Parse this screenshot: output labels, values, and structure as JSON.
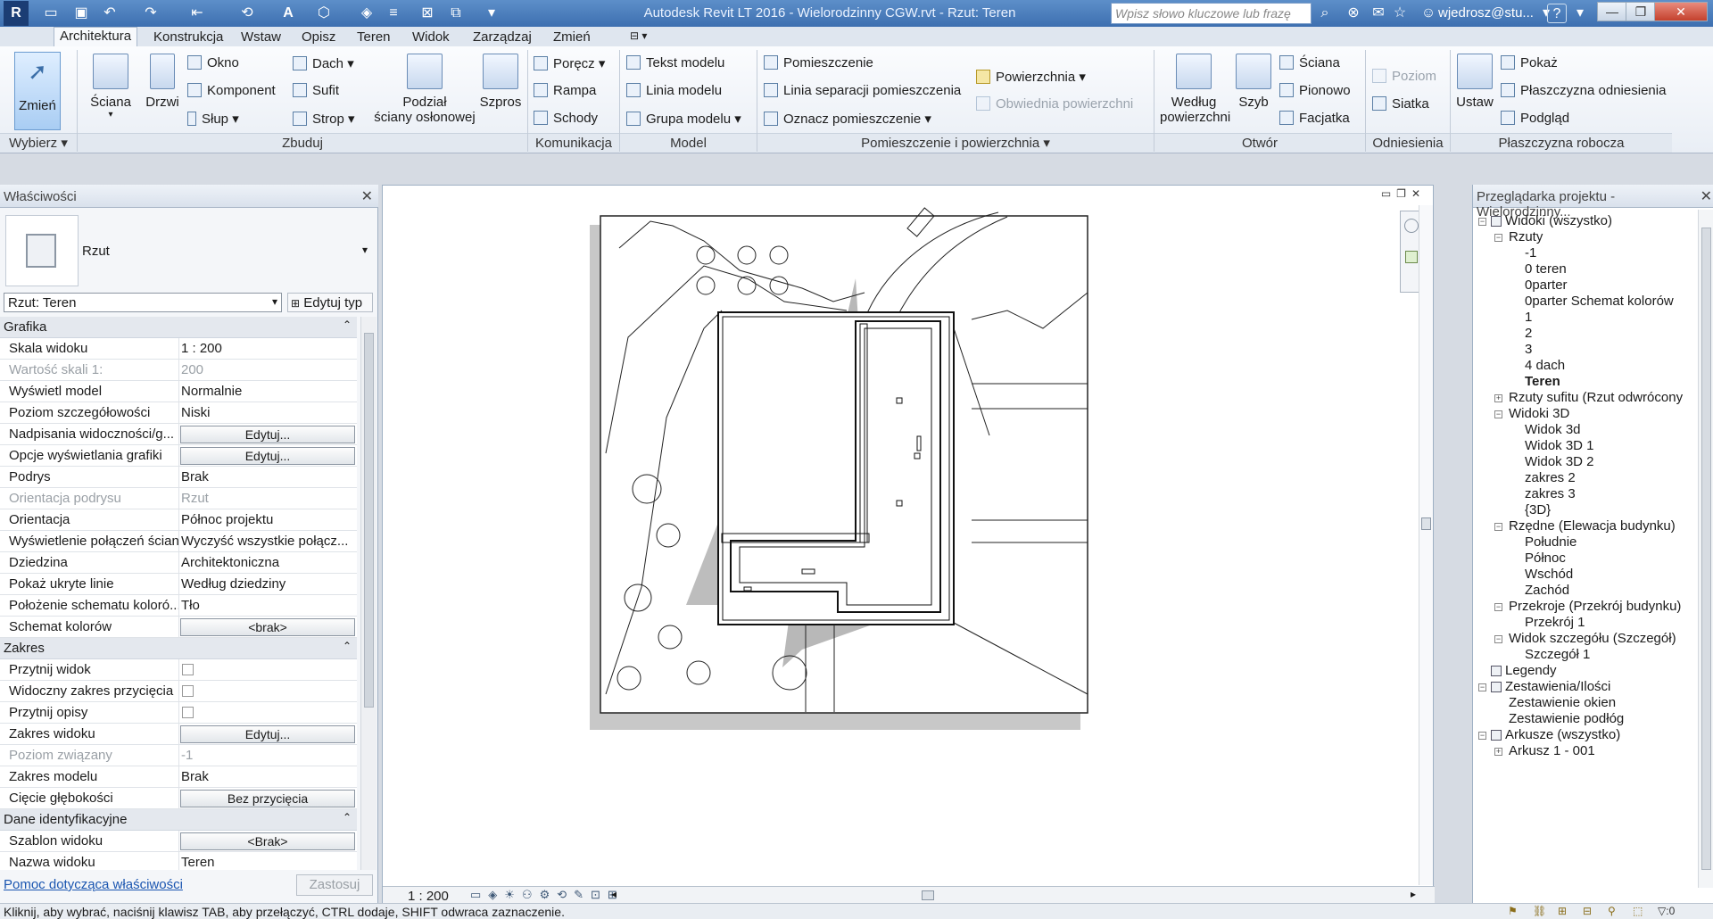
{
  "titlebar": {
    "title": "Autodesk Revit LT 2016 -    Wielorodzinny CGW.rvt - Rzut: Teren",
    "search_placeholder": "Wpisz słowo kluczowe lub frazę",
    "user": "wjedrosz@stu..."
  },
  "tabs": [
    "Architektura",
    "Konstrukcja",
    "Wstaw",
    "Opisz",
    "Teren",
    "Widok",
    "Zarządzaj",
    "Zmień"
  ],
  "ribbon": {
    "select": {
      "label": "Zmień",
      "group": "Wybierz"
    },
    "build": {
      "group": "Zbuduj",
      "wall": "Ściana",
      "door": "Drzwi",
      "window": "Okno",
      "component": "Komponent",
      "column": "Słup",
      "roof": "Dach",
      "ceiling": "Sufit",
      "floor": "Strop",
      "curtain1": "Podział",
      "curtain2": "ściany osłonowej",
      "mullion": "Szpros"
    },
    "circulation": {
      "group": "Komunikacja",
      "railing": "Poręcz",
      "ramp": "Rampa",
      "stair": "Schody"
    },
    "model": {
      "group": "Model",
      "text": "Tekst modelu",
      "line": "Linia modelu",
      "groupm": "Grupa modelu"
    },
    "room": {
      "group": "Pomieszczenie i powierzchnia",
      "room": "Pomieszczenie",
      "separator": "Linia separacji  pomieszczenia",
      "tag": "Oznacz  pomieszczenie",
      "area": "Powierzchnia",
      "boundary": "Obwiednia  powierzchni"
    },
    "opening": {
      "group": "Otwór",
      "byface1": "Według",
      "byface2": "powierzchni",
      "shaft": "Szyb",
      "wall": "Ściana",
      "vertical": "Pionowo",
      "dormer": "Facjatka"
    },
    "datum": {
      "group": "Odniesienia",
      "level": "Poziom",
      "grid": "Siatka"
    },
    "workplane": {
      "group": "Płaszczyzna robocza",
      "set": "Ustaw",
      "show": "Pokaż",
      "ref": "Płaszczyzna odniesienia",
      "viewer": "Podgląd"
    }
  },
  "properties": {
    "header": "Właściwości",
    "type": "Rzut",
    "selector": "Rzut: Teren",
    "edit_type": "Edytuj typ",
    "sections": {
      "graphics": "Grafika",
      "extents": "Zakres",
      "identity": "Dane identyfikacyjne"
    },
    "rows": [
      {
        "k": "Skala widoku",
        "v": "1 : 200"
      },
      {
        "k": "Wartość skali    1:",
        "v": "200"
      },
      {
        "k": "Wyświetl model",
        "v": "Normalnie"
      },
      {
        "k": "Poziom szczegółowości",
        "v": "Niski"
      },
      {
        "k": "Nadpisania widoczności/g...",
        "v": "Edytuj..."
      },
      {
        "k": "Opcje wyświetlania grafiki",
        "v": "Edytuj..."
      },
      {
        "k": "Podrys",
        "v": "Brak"
      },
      {
        "k": "Orientacja podrysu",
        "v": "Rzut"
      },
      {
        "k": "Orientacja",
        "v": "Północ projektu"
      },
      {
        "k": "Wyświetlenie połączeń ścian",
        "v": "Wyczyść wszystkie połącz..."
      },
      {
        "k": "Dziedzina",
        "v": "Architektoniczna"
      },
      {
        "k": "Pokaż ukryte linie",
        "v": "Według dziedziny"
      },
      {
        "k": "Położenie schematu koloró...",
        "v": "Tło"
      },
      {
        "k": "Schemat kolorów",
        "v": "<brak>"
      },
      {
        "k": "Przytnij widok",
        "v": ""
      },
      {
        "k": "Widoczny zakres przycięcia",
        "v": ""
      },
      {
        "k": "Przytnij opisy",
        "v": ""
      },
      {
        "k": "Zakres widoku",
        "v": "Edytuj..."
      },
      {
        "k": "Poziom związany",
        "v": "-1"
      },
      {
        "k": "Zakres modelu",
        "v": "Brak"
      },
      {
        "k": "Cięcie głębokości",
        "v": "Bez przycięcia"
      },
      {
        "k": "Szablon widoku",
        "v": "<Brak>"
      },
      {
        "k": "Nazwa widoku",
        "v": "Teren"
      }
    ],
    "help": "Pomoc dotycząca właściwości",
    "apply": "Zastosuj"
  },
  "viewbar": {
    "scale": "1 : 200"
  },
  "browser": {
    "header": "Przeglądarka projektu - Wielorodzinny...",
    "nodes": [
      "Widoki (wszystko)",
      "Rzuty",
      "-1",
      "0 teren",
      "0parter",
      "0parter Schemat kolorów",
      "1",
      "2",
      "3",
      "4 dach",
      "Teren",
      "Rzuty sufitu (Rzut odwrócony",
      "Widoki 3D",
      "Widok 3d",
      "Widok 3D 1",
      "Widok 3D 2",
      "zakres 2",
      "zakres 3",
      "{3D}",
      "Rzędne (Elewacja budynku)",
      "Południe",
      "Północ",
      "Wschód",
      "Zachód",
      "Przekroje (Przekrój budynku)",
      "Przekrój 1",
      "Widok szczegółu (Szczegół)",
      "Szczegół 1",
      "Legendy",
      "Zestawienia/Ilości",
      "Zestawienie okien",
      "Zestawienie podłóg",
      "Arkusze (wszystko)",
      "Arkusz 1 - 001"
    ]
  },
  "status": {
    "text": "Kliknij, aby wybrać, naciśnij klawisz TAB, aby przełączyć, CTRL dodaje, SHIFT odwraca zaznaczenie.",
    "filter_count": ":0"
  }
}
